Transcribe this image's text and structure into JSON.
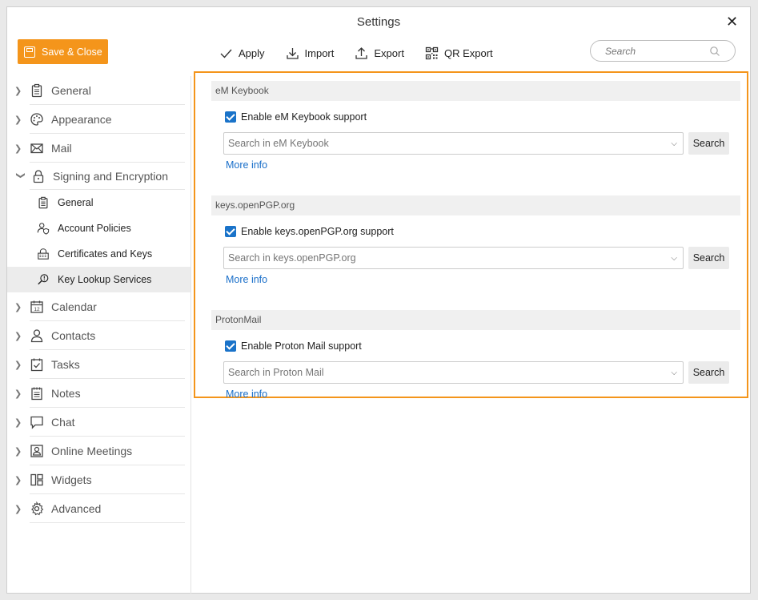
{
  "window": {
    "title": "Settings",
    "close_glyph": "✕"
  },
  "save_close": {
    "label": "Save & Close",
    "icon": "floppy-disk-icon",
    "color": "#f4951b"
  },
  "toolbar": {
    "apply": "Apply",
    "import": "Import",
    "export": "Export",
    "qr_export": "QR Export"
  },
  "search": {
    "placeholder": "Search"
  },
  "sidebar": {
    "items": [
      {
        "label": "General",
        "icon": "clipboard-icon"
      },
      {
        "label": "Appearance",
        "icon": "palette-icon"
      },
      {
        "label": "Mail",
        "icon": "envelope-icon"
      },
      {
        "label": "Signing and Encryption",
        "icon": "lock-icon",
        "expanded": true
      },
      {
        "label": "Calendar",
        "icon": "calendar-icon"
      },
      {
        "label": "Contacts",
        "icon": "person-icon"
      },
      {
        "label": "Tasks",
        "icon": "task-checklist-icon"
      },
      {
        "label": "Notes",
        "icon": "notes-icon"
      },
      {
        "label": "Chat",
        "icon": "chat-bubble-icon"
      },
      {
        "label": "Online Meetings",
        "icon": "meeting-icon"
      },
      {
        "label": "Widgets",
        "icon": "widgets-icon"
      },
      {
        "label": "Advanced",
        "icon": "gear-icon"
      }
    ],
    "sub_items": [
      {
        "label": "General",
        "icon": "clipboard-icon"
      },
      {
        "label": "Account Policies",
        "icon": "account-shield-icon"
      },
      {
        "label": "Certificates and Keys",
        "icon": "certificate-lock-icon"
      },
      {
        "label": "Key Lookup Services",
        "icon": "key-search-icon",
        "selected": true
      }
    ],
    "calendar_icon_number": "12"
  },
  "content": {
    "sections": [
      {
        "heading": "eM Keybook",
        "checkbox_label": "Enable eM Keybook support",
        "checked": true,
        "placeholder": "Search in eM Keybook",
        "search_button": "Search",
        "more_info": "More info"
      },
      {
        "heading": "keys.openPGP.org",
        "checkbox_label": "Enable keys.openPGP.org support",
        "checked": true,
        "placeholder": "Search in keys.openPGP.org",
        "search_button": "Search",
        "more_info": "More info"
      },
      {
        "heading": "ProtonMail",
        "checkbox_label": "Enable Proton Mail support",
        "checked": true,
        "placeholder": "Search in Proton Mail",
        "search_button": "Search",
        "more_info": "More info"
      }
    ],
    "highlight_color": "#f4951b",
    "checkbox_color": "#1a73c9",
    "link_color": "#1a6fc9"
  }
}
